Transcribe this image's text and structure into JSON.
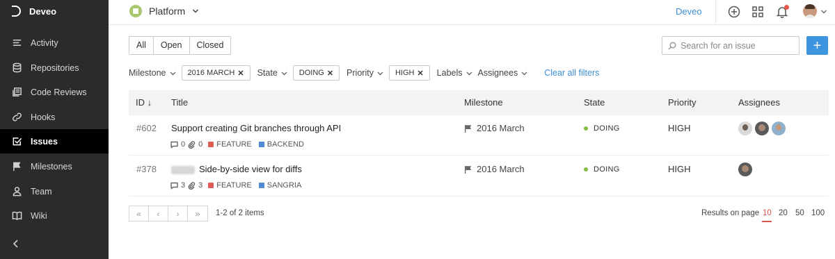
{
  "app": {
    "brand": "Deveo"
  },
  "sidebar": {
    "items": [
      {
        "label": "Activity",
        "icon": "activity-icon"
      },
      {
        "label": "Repositories",
        "icon": "database-icon"
      },
      {
        "label": "Code Reviews",
        "icon": "code-review-icon"
      },
      {
        "label": "Hooks",
        "icon": "link-icon"
      },
      {
        "label": "Issues",
        "icon": "checkbox-icon",
        "active": true
      },
      {
        "label": "Milestones",
        "icon": "flag-icon"
      },
      {
        "label": "Team",
        "icon": "user-icon"
      },
      {
        "label": "Wiki",
        "icon": "book-icon"
      }
    ]
  },
  "topbar": {
    "project": "Platform",
    "org_link": "Deveo"
  },
  "toolbar": {
    "segments": [
      "All",
      "Open",
      "Closed"
    ],
    "search_placeholder": "Search for an issue",
    "add_label": "+"
  },
  "filters": {
    "milestone_label": "Milestone",
    "milestone_value": "2016 MARCH",
    "state_label": "State",
    "state_value": "DOING",
    "priority_label": "Priority",
    "priority_value": "HIGH",
    "labels_label": "Labels",
    "assignees_label": "Assignees",
    "clear": "Clear all filters",
    "remove_glyph": "✕"
  },
  "table": {
    "headers": {
      "id": "ID",
      "id_sort": "↓",
      "title": "Title",
      "milestone": "Milestone",
      "state": "State",
      "priority": "Priority",
      "assignees": "Assignees"
    },
    "rows": [
      {
        "id": "#602",
        "title": "Support creating Git branches through API",
        "comments": "0",
        "attachments": "0",
        "labels": [
          {
            "name": "FEATURE",
            "color": "#e05b55"
          },
          {
            "name": "BACKEND",
            "color": "#4f8ad6"
          }
        ],
        "milestone": "2016 March",
        "state": "DOING",
        "state_color": "#7fbf3f",
        "priority": "HIGH"
      },
      {
        "id": "#378",
        "title": "Side-by-side view for diffs",
        "comments": "3",
        "attachments": "3",
        "labels": [
          {
            "name": "FEATURE",
            "color": "#e05b55"
          },
          {
            "name": "SANGRIA",
            "color": "#4f8ad6"
          }
        ],
        "milestone": "2016 March",
        "state": "DOING",
        "state_color": "#7fbf3f",
        "priority": "HIGH"
      }
    ]
  },
  "pagination": {
    "buttons": [
      "«",
      "‹",
      "›",
      "»"
    ],
    "info": "1-2 of 2 items",
    "results_label": "Results on page",
    "sizes": [
      "10",
      "20",
      "50",
      "100"
    ],
    "selected": "10"
  }
}
